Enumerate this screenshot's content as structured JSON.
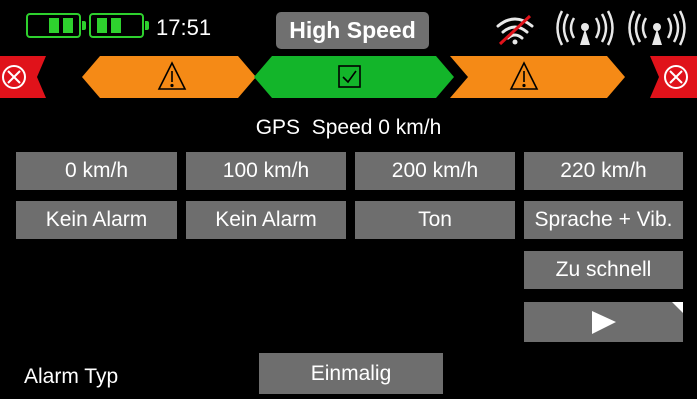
{
  "status": {
    "time": "17:51",
    "mode_title": "High Speed",
    "icons": [
      "battery-icon",
      "battery-icon",
      "wifi-off-icon",
      "antenna-signal-icon",
      "antenna-signal-icon"
    ],
    "accent": "#2ed12e"
  },
  "zones": {
    "colors": {
      "red": "#e0121a",
      "orange": "#f58a16",
      "green": "#13b52a"
    },
    "icons": [
      "cancel-icon",
      "warning-icon",
      "check-icon",
      "warning-icon",
      "cancel-icon"
    ]
  },
  "speed_label": "GPS  Speed 0 km/h",
  "thresholds": [
    "0 km/h",
    "100 km/h",
    "200 km/h",
    "220 km/h"
  ],
  "alarms": [
    "Kein Alarm",
    "Kein Alarm",
    "Ton",
    "Sprache + Vib."
  ],
  "announcement": "Zu schnell",
  "play_icon": "play-icon",
  "alarm_type": {
    "label": "Alarm Typ",
    "value": "Einmalig"
  }
}
